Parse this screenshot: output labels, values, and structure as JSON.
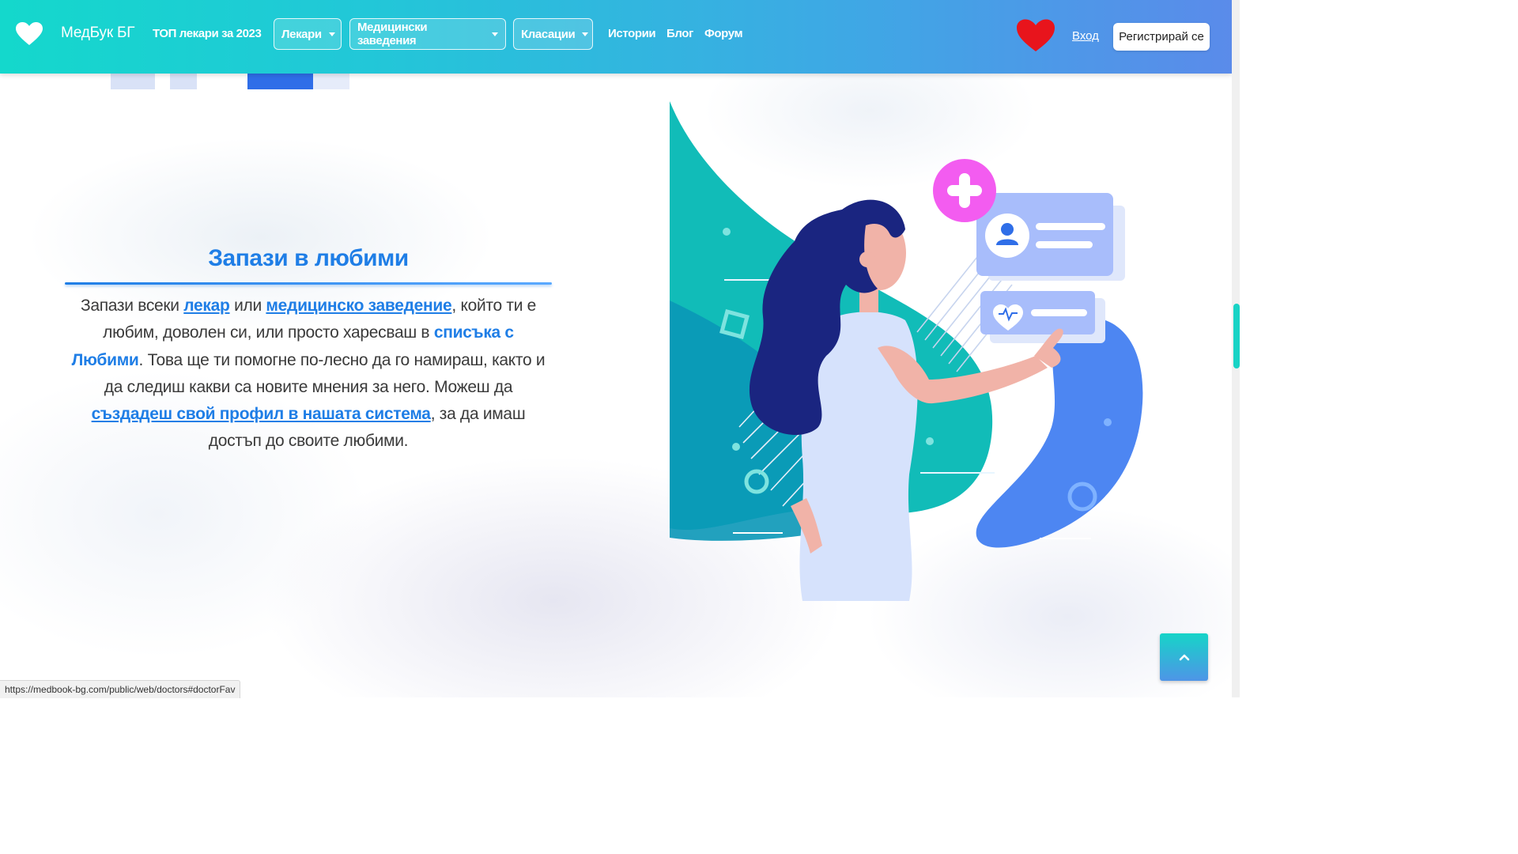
{
  "navbar": {
    "brand": "МедБук БГ",
    "top_doctors": "ТОП лекари за 2023",
    "dropdowns": [
      {
        "label": "Лекари"
      },
      {
        "label": "Медицински заведения"
      },
      {
        "label": "Класации"
      }
    ],
    "links": [
      {
        "label": "Истории"
      },
      {
        "label": "Блог"
      },
      {
        "label": "Форум"
      }
    ],
    "login": "Вход",
    "register": "Регистрирай се"
  },
  "section": {
    "title": "Запази в любими",
    "text_1": "Запази всеки ",
    "link_doctor": "лекар",
    "text_2": " или ",
    "link_facility": "медицинско заведение",
    "text_3": ", който ти е любим, доволен си, или просто харесваш в ",
    "favorites_list": "списъка с Любими",
    "text_4": ". Това ще ти помогне по-лесно да го намираш, както и да следиш какви са новите мнения за него. Можеш да ",
    "link_profile": "създадеш свой профил в нашата система",
    "text_5": ", за да имаш достъп до своите любими."
  },
  "status_bar": {
    "url": "https://medbook-bg.com/public/web/doctors#doctorFav"
  },
  "colors": {
    "nav_gradient_start": "#14d8cc",
    "nav_gradient_end": "#5a8bea",
    "accent_blue": "#1f7ee6",
    "heart_red": "#e8141c",
    "teal": "#0fbfb8",
    "pink": "#f35cf0"
  },
  "icons": {
    "brand": "heart-icon",
    "favorites": "heart-icon",
    "scroll_top": "chevron-up-icon"
  }
}
